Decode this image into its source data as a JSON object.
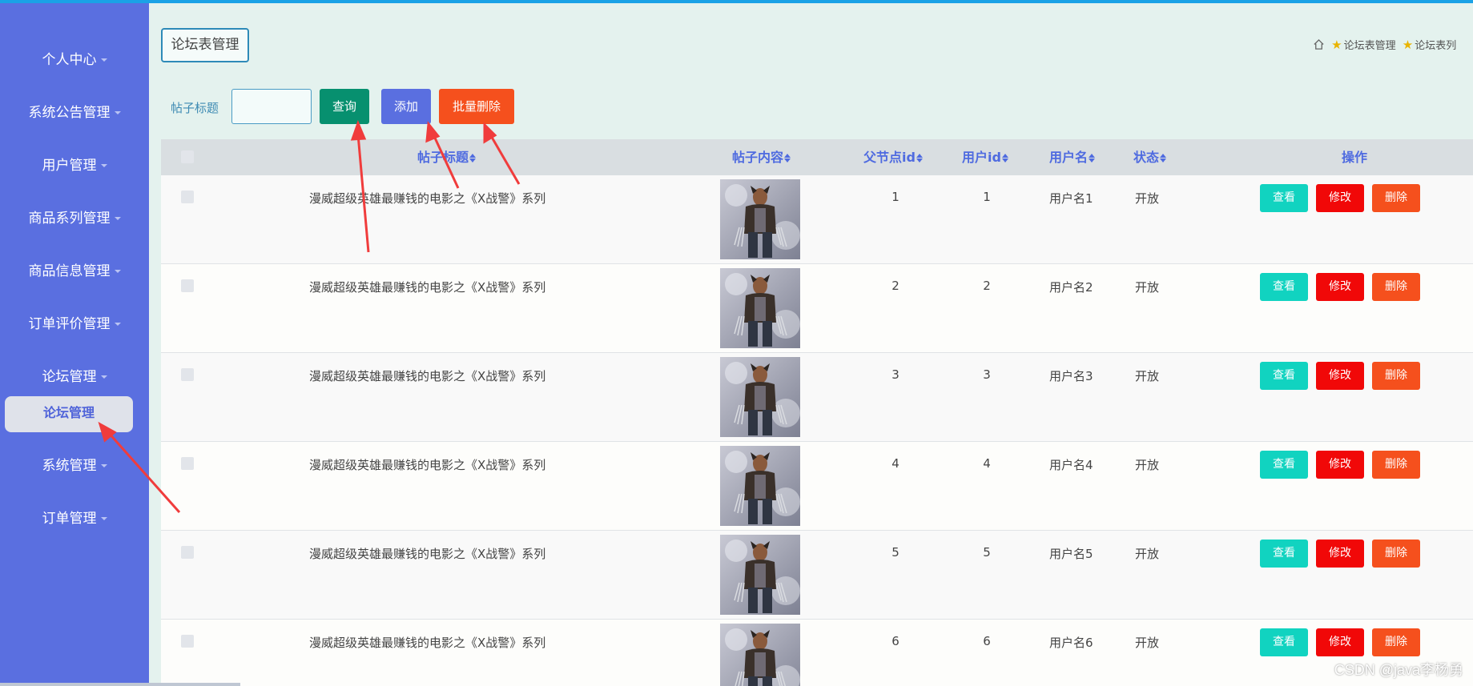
{
  "sidebar": {
    "items": [
      {
        "label": "个人中心"
      },
      {
        "label": "系统公告管理"
      },
      {
        "label": "用户管理"
      },
      {
        "label": "商品系列管理"
      },
      {
        "label": "商品信息管理"
      },
      {
        "label": "订单评价管理"
      },
      {
        "label": "论坛管理"
      },
      {
        "label": "系统管理"
      },
      {
        "label": "订单管理"
      }
    ],
    "active_subitem": "论坛管理"
  },
  "header": {
    "page_title": "论坛表管理",
    "breadcrumb": [
      "论坛表管理",
      "论坛表列"
    ]
  },
  "search": {
    "label": "帖子标题",
    "value": "",
    "query_label": "查询",
    "add_label": "添加",
    "batch_delete_label": "批量删除"
  },
  "table": {
    "headers": {
      "title": "帖子标题",
      "content": "帖子内容",
      "parent_id": "父节点id",
      "user_id": "用户id",
      "username": "用户名",
      "status": "状态",
      "actions": "操作"
    },
    "action_labels": {
      "view": "查看",
      "edit": "修改",
      "delete": "删除"
    },
    "rows": [
      {
        "title": "漫威超级英雄最赚钱的电影之《X战警》系列",
        "parent_id": "1",
        "user_id": "1",
        "username": "用户名1",
        "status": "开放"
      },
      {
        "title": "漫威超级英雄最赚钱的电影之《X战警》系列",
        "parent_id": "2",
        "user_id": "2",
        "username": "用户名2",
        "status": "开放"
      },
      {
        "title": "漫威超级英雄最赚钱的电影之《X战警》系列",
        "parent_id": "3",
        "user_id": "3",
        "username": "用户名3",
        "status": "开放"
      },
      {
        "title": "漫威超级英雄最赚钱的电影之《X战警》系列",
        "parent_id": "4",
        "user_id": "4",
        "username": "用户名4",
        "status": "开放"
      },
      {
        "title": "漫威超级英雄最赚钱的电影之《X战警》系列",
        "parent_id": "5",
        "user_id": "5",
        "username": "用户名5",
        "status": "开放"
      },
      {
        "title": "漫威超级英雄最赚钱的电影之《X战警》系列",
        "parent_id": "6",
        "user_id": "6",
        "username": "用户名6",
        "status": "开放"
      }
    ]
  },
  "watermark": "CSDN @java李杨勇",
  "colors": {
    "sidebar": "#5a6fe0",
    "query": "#07906f",
    "add": "#5a6fe0",
    "batch_delete": "#f5501d",
    "view": "#11d3c0",
    "edit": "#f10808",
    "delete": "#f5501d",
    "annotation_arrow": "#f03c3c"
  }
}
